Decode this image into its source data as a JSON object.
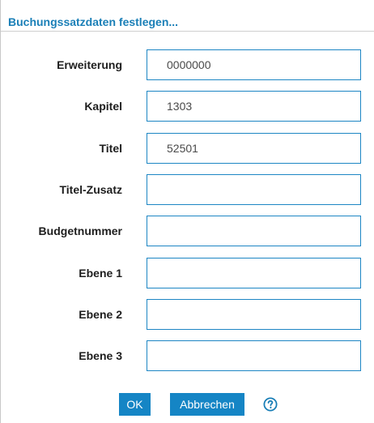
{
  "dialog": {
    "title": "Buchungssatzdaten festlegen..."
  },
  "fields": [
    {
      "label": "Erweiterung",
      "value": "0000000"
    },
    {
      "label": "Kapitel",
      "value": "1303"
    },
    {
      "label": "Titel",
      "value": "52501"
    },
    {
      "label": "Titel-Zusatz",
      "value": ""
    },
    {
      "label": "Budgetnummer",
      "value": ""
    },
    {
      "label": "Ebene 1",
      "value": ""
    },
    {
      "label": "Ebene 2",
      "value": ""
    },
    {
      "label": "Ebene 3",
      "value": ""
    }
  ],
  "buttons": {
    "ok_label": "OK",
    "cancel_label": "Abbrechen",
    "help_icon": "help-circle-icon"
  },
  "colors": {
    "accent": "#1585c5",
    "title": "#1a7fb7",
    "field_border": "#1d86c4"
  }
}
